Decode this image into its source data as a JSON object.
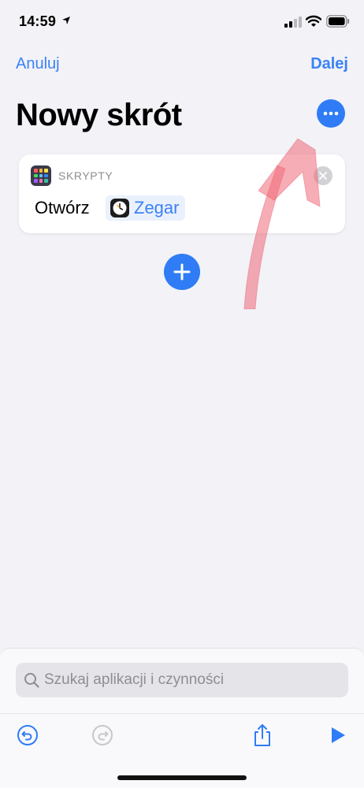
{
  "status_bar": {
    "time": "14:59"
  },
  "nav": {
    "cancel_label": "Anuluj",
    "next_label": "Dalej"
  },
  "page": {
    "title": "Nowy skrót"
  },
  "action": {
    "category": "SKRYPTY",
    "verb": "Otwórz",
    "app_name": "Zegar",
    "icon": "scripts-icon",
    "app_icon": "clock-icon"
  },
  "search": {
    "placeholder": "Szukaj aplikacji i czynności",
    "value": ""
  },
  "colors": {
    "accent": "#2f7cf6",
    "background": "#f2f2f7",
    "annotation": "#f06a78"
  }
}
